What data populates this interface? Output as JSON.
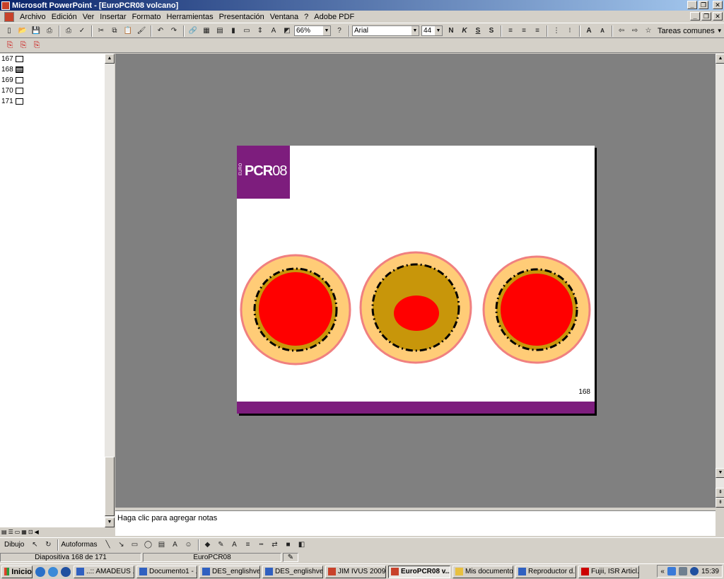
{
  "window": {
    "title": "Microsoft PowerPoint - [EuroPCR08 volcano]"
  },
  "menu": [
    "Archivo",
    "Edición",
    "Ver",
    "Insertar",
    "Formato",
    "Herramientas",
    "Presentación",
    "Ventana",
    "?",
    "Adobe PDF"
  ],
  "toolbar": {
    "zoom": "66%",
    "font": "Arial",
    "font_size": "44",
    "bold": "N",
    "italic": "K",
    "underline": "S",
    "shadow": "S",
    "tasks": "Tareas comunes"
  },
  "outline": {
    "items": [
      {
        "num": "167",
        "active": false
      },
      {
        "num": "168",
        "active": true
      },
      {
        "num": "169",
        "active": false
      },
      {
        "num": "170",
        "active": false
      },
      {
        "num": "171",
        "active": false
      }
    ]
  },
  "slide": {
    "logo_prefix": "EURO",
    "logo_main": "PCR",
    "logo_year": "08",
    "page_number": "168",
    "colors": {
      "brand": "#7d1d7d",
      "outer": "#ffcc77",
      "ring": "#f08080",
      "plaque": "#c8960a",
      "lumen": "#ff0000"
    }
  },
  "notes": {
    "placeholder": "Haga clic para agregar notas"
  },
  "drawbar": {
    "draw": "Dibujo",
    "autoshapes": "Autoformas"
  },
  "status": {
    "slide": "Diapositiva 168 de 171",
    "design": "EuroPCR08"
  },
  "taskbar": {
    "start": "Inicio",
    "tasks": [
      {
        "label": "..:: AMADEUS ...",
        "active": false
      },
      {
        "label": "Documento1 - ...",
        "active": false
      },
      {
        "label": "DES_englishve...",
        "active": false
      },
      {
        "label": "DES_englishve...",
        "active": false
      },
      {
        "label": "JIM IVUS 2009",
        "active": false
      },
      {
        "label": "EuroPCR08 v...",
        "active": true
      },
      {
        "label": "Mis documentos",
        "active": false
      },
      {
        "label": "Reproductor d...",
        "active": false
      },
      {
        "label": "Fujii, ISR Articl...",
        "active": false
      }
    ],
    "clock": "15:39"
  }
}
